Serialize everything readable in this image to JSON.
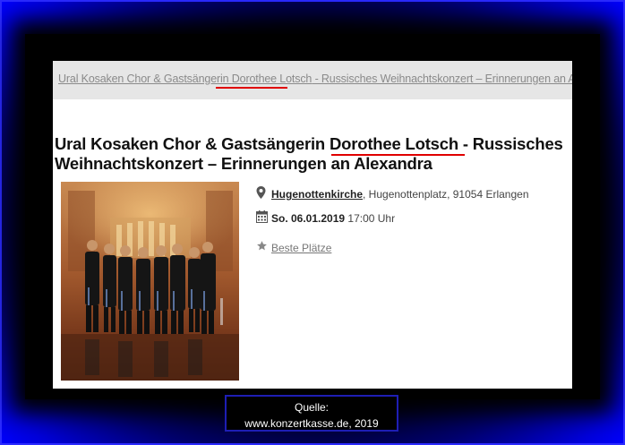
{
  "breadcrumb": {
    "before": "Ural Kosaken Chor & Gastsängerin ",
    "highlight": "Dorothee Lotsch",
    "after": " - Russisches Weihnachtskonzert – Erinnerungen an Alexandra"
  },
  "event": {
    "title_before": "Ural Kosaken Chor & Gastsängerin ",
    "title_highlight": "Dorothee Lotsch",
    "title_after": " - Russisches Weihnachtskonzert – Erinnerungen an Alexandra",
    "venue_name": "Hugenottenkirche",
    "venue_address": ", Hugenottenplatz, 91054 Erlangen",
    "date": "So. 06.01.2019",
    "time": " 17:00 Uhr",
    "best_seats_label": "Beste Plätze"
  },
  "icons": {
    "location": "map-pin-icon",
    "calendar": "calendar-icon",
    "star": "star-icon"
  },
  "colors": {
    "highlight_underline": "#e00000",
    "frame_blue": "#0000ff"
  },
  "source": {
    "label": "Quelle:",
    "text": "www.konzertkasse.de,  2019"
  }
}
